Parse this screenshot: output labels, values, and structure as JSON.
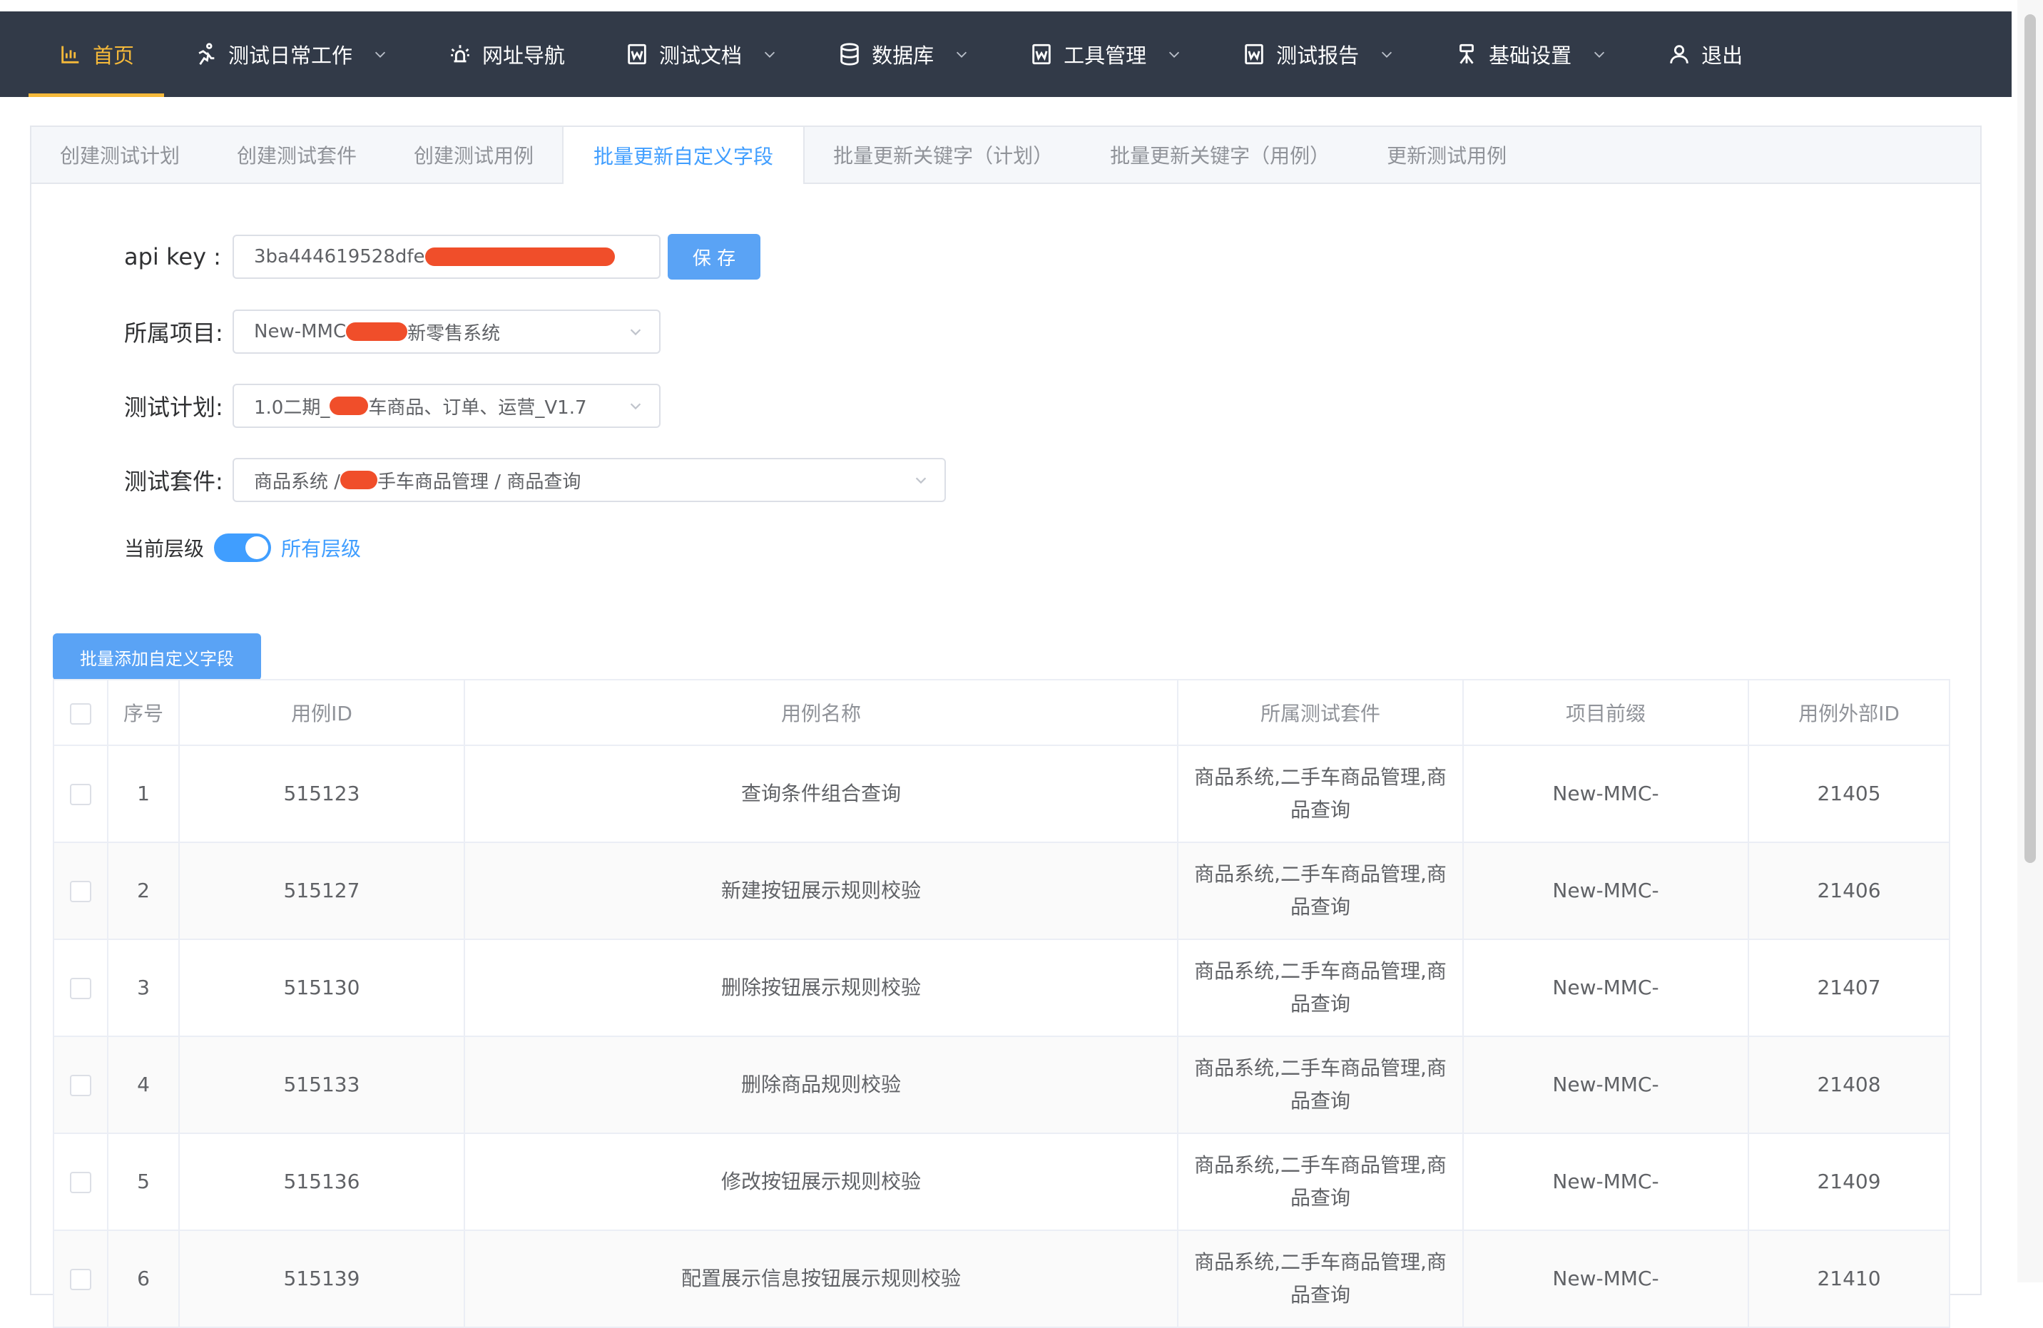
{
  "nav": {
    "items": [
      {
        "label": "首页",
        "icon": "bar-chart-icon"
      },
      {
        "label": "测试日常工作",
        "icon": "running-icon"
      },
      {
        "label": "网址导航",
        "icon": "alarm-icon"
      },
      {
        "label": "测试文档",
        "icon": "word-doc-icon"
      },
      {
        "label": "数据库",
        "icon": "database-icon"
      },
      {
        "label": "工具管理",
        "icon": "word-doc-icon"
      },
      {
        "label": "测试报告",
        "icon": "word-doc-icon"
      },
      {
        "label": "基础设置",
        "icon": "tripod-icon"
      },
      {
        "label": "退出",
        "icon": "user-icon"
      }
    ],
    "active_color": "#f5b93a",
    "bg_color": "#323a48"
  },
  "tabs": [
    {
      "label": "创建测试计划"
    },
    {
      "label": "创建测试套件"
    },
    {
      "label": "创建测试用例"
    },
    {
      "label": "批量更新自定义字段"
    },
    {
      "label": "批量更新关键字（计划）"
    },
    {
      "label": "批量更新关键字（用例）"
    },
    {
      "label": "更新测试用例"
    }
  ],
  "form": {
    "api_key_label": "api key :",
    "api_key_value": "3ba444619528dfe",
    "save_label": "保 存",
    "project_label": "所属项目:",
    "project_prefix": "New-MMC",
    "project_suffix": "新零售系统",
    "plan_label": "测试计划:",
    "plan_prefix": "1.0二期_",
    "plan_suffix": "车商品、订单、运营_V1.7",
    "suite_label": "测试套件:",
    "suite_prefix": "商品系统 / ",
    "suite_suffix": "手车商品管理 / 商品查询",
    "level_label": "当前层级",
    "level_switch_text": "所有层级",
    "batch_add_label": "批量添加自定义字段"
  },
  "table": {
    "headers": {
      "index": "序号",
      "case_id": "用例ID",
      "case_name": "用例名称",
      "suite": "所属测试套件",
      "prefix": "项目前缀",
      "external_id": "用例外部ID"
    },
    "rows": [
      {
        "index": "1",
        "case_id": "515123",
        "case_name": "查询条件组合查询",
        "suite_line1": "商品系统,二手车商品管理,商",
        "suite_line2": "品查询",
        "prefix": "New-MMC-",
        "external_id": "21405"
      },
      {
        "index": "2",
        "case_id": "515127",
        "case_name": "新建按钮展示规则校验",
        "suite_line1": "商品系统,二手车商品管理,商",
        "suite_line2": "品查询",
        "prefix": "New-MMC-",
        "external_id": "21406"
      },
      {
        "index": "3",
        "case_id": "515130",
        "case_name": "删除按钮展示规则校验",
        "suite_line1": "商品系统,二手车商品管理,商",
        "suite_line2": "品查询",
        "prefix": "New-MMC-",
        "external_id": "21407"
      },
      {
        "index": "4",
        "case_id": "515133",
        "case_name": "删除商品规则校验",
        "suite_line1": "商品系统,二手车商品管理,商",
        "suite_line2": "品查询",
        "prefix": "New-MMC-",
        "external_id": "21408"
      },
      {
        "index": "5",
        "case_id": "515136",
        "case_name": "修改按钮展示规则校验",
        "suite_line1": "商品系统,二手车商品管理,商",
        "suite_line2": "品查询",
        "prefix": "New-MMC-",
        "external_id": "21409"
      },
      {
        "index": "6",
        "case_id": "515139",
        "case_name": "配置展示信息按钮展示规则校验",
        "suite_line1": "商品系统,二手车商品管理,商",
        "suite_line2": "品查询",
        "prefix": "New-MMC-",
        "external_id": "21410"
      }
    ]
  }
}
